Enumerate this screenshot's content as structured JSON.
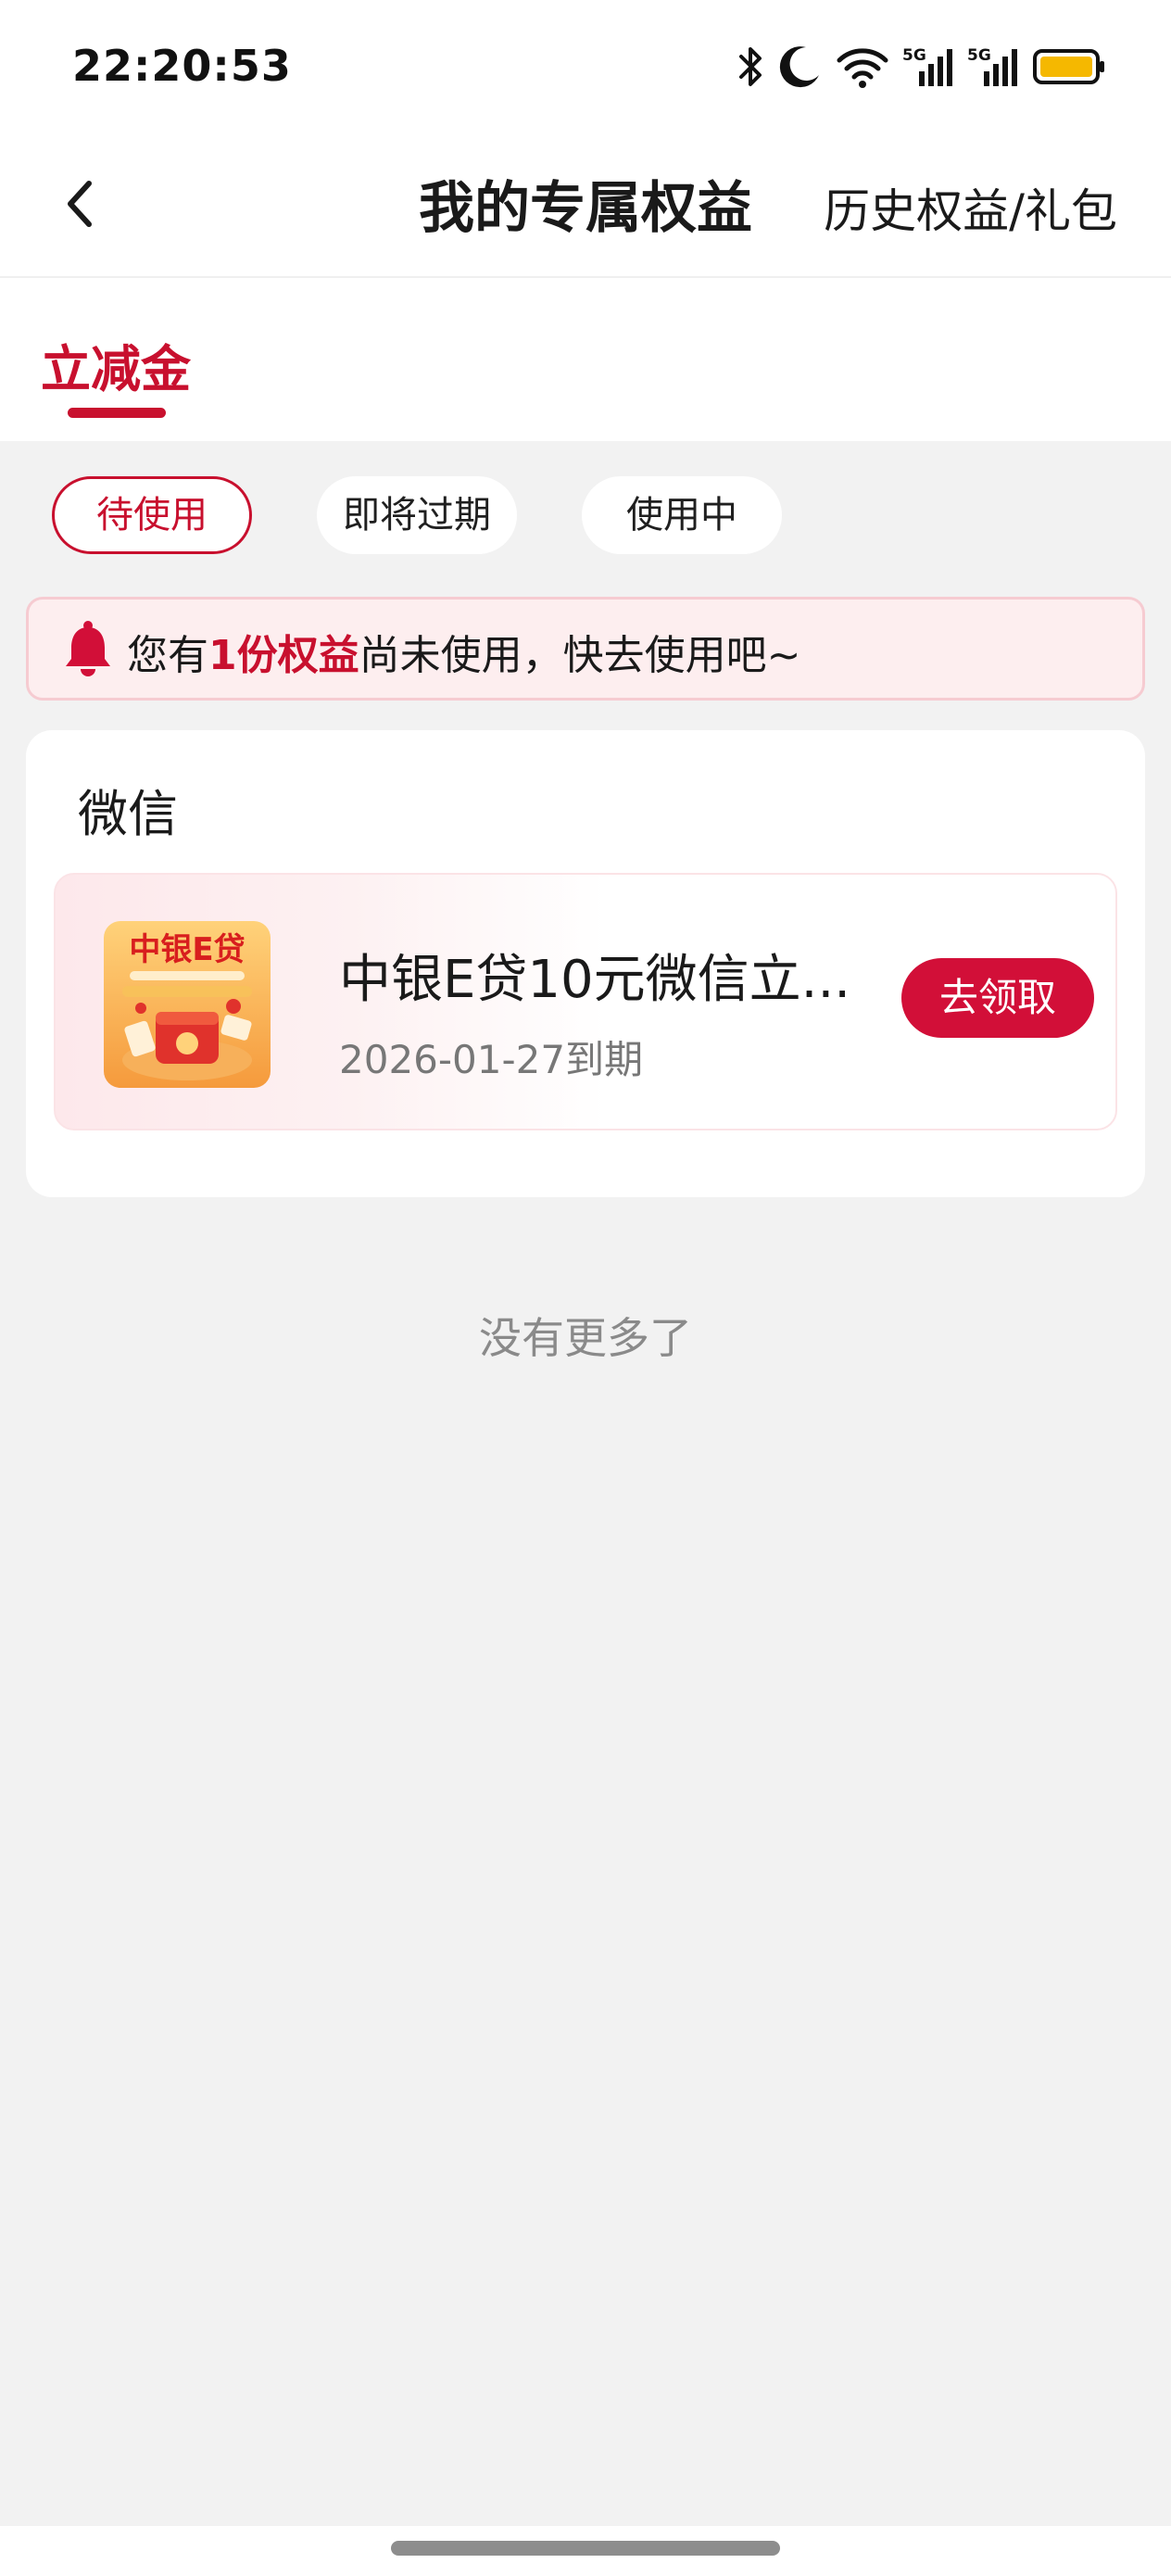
{
  "status_bar": {
    "time": "22:20:53",
    "icons": [
      "bluetooth-icon",
      "moon-icon",
      "wifi-icon",
      "signal-5g-icon",
      "signal-5g-icon",
      "battery-icon"
    ],
    "battery_color": "#f5b800"
  },
  "header": {
    "title": "我的专属权益",
    "history_link": "历史权益/礼包"
  },
  "tabs": [
    {
      "label": "立减金",
      "active": true
    }
  ],
  "filters": [
    {
      "label": "待使用",
      "active": true
    },
    {
      "label": "即将过期",
      "active": false
    },
    {
      "label": "使用中",
      "active": false
    }
  ],
  "notice": {
    "prefix": "您有",
    "highlight": "1份权益",
    "suffix": "尚未使用，快去使用吧~"
  },
  "section": {
    "title": "微信",
    "coupon": {
      "name": "中银E贷10元微信立...",
      "expiry": "2026-01-27到期",
      "action": "去领取",
      "thumb_text": "中银E贷"
    }
  },
  "footer_text": "没有更多了",
  "colors": {
    "accent": "#c8102e",
    "button": "#d20f38",
    "background": "#f2f2f2",
    "notice_bg": "#fdeeef"
  }
}
